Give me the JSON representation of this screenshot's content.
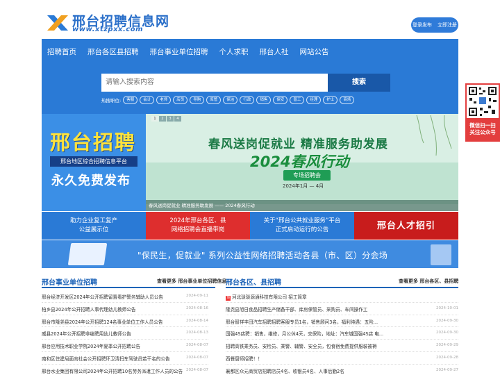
{
  "site": {
    "title": "邢台招聘信息网",
    "url": "www.xtzpxx.com",
    "brand_color": "#2a7ad6",
    "logo_icon": "x-logo-icon"
  },
  "account": {
    "login": "登录发布",
    "register": "立即注册"
  },
  "nav": [
    "招聘首页",
    "邢台各区县招聘",
    "邢台事业单位招聘",
    "个人求职",
    "邢台人社",
    "网站公告"
  ],
  "search": {
    "placeholder": "请输入搜索内容",
    "button": "搜索",
    "hot_label": "热搜职位:",
    "hot_tags": [
      "客服",
      "会计",
      "老师",
      "店员",
      "导购",
      "库管",
      "保洁",
      "行政",
      "销售",
      "保安",
      "普工",
      "经理",
      "护士",
      "商场"
    ]
  },
  "ad_left": {
    "title": "邢台招聘",
    "subtitle": "邢台地区综合招聘信息平台",
    "slogan": "永久免费发布"
  },
  "slide": {
    "pages": [
      "1",
      "2",
      "3",
      "4"
    ],
    "active_page": "1",
    "headline": "春风送岗促就业 精准服务助发展",
    "big": "2024春风行动",
    "pill": "专场招聘会",
    "date": "2024年1月 — 4月",
    "caption": "春风送岗促就业 精准服务助发展 —— 2024春风行动"
  },
  "ads4": {
    "a": [
      "助力企业复工复产",
      "公益展示位"
    ],
    "b": [
      "2024年邢台各区、县",
      "网络招聘会直播带岗"
    ],
    "c": [
      "关于“邢台公共就业服务”平台",
      "正式启动运行的公告"
    ],
    "d": "邢台人才招引"
  },
  "wide_banner": "\"保民生，促就业\" 系列公益性网络招聘活动各县（市、区）分会场",
  "sections": {
    "left": {
      "title": "邢台事业单位招聘",
      "more": "查看更多 邢台事业单位招聘信息",
      "items": [
        {
          "title": "邢台经济开发区2024年公开招聘留置看护警务辅助人员公告",
          "date": "2024-09-11"
        },
        {
          "title": "柏乡县2024年公开招聘人事代理幼儿教师公告",
          "date": "2024-08-16"
        },
        {
          "title": "邢台市隆尧县2024年公开招聘124名事业单位工作人员公告",
          "date": "2024-08-14"
        },
        {
          "title": "威县2024年公开招聘非编聘用幼儿教师公告",
          "date": "2024-08-13"
        },
        {
          "title": "邢台应用技术职业学院2024年夏季公开招聘公告",
          "date": "2024-08-07"
        },
        {
          "title": "南和区住建局面向社会公开招聘环卫清扫车驾驶员若干名的公告",
          "date": "2024-08-07"
        },
        {
          "title": "邢台水业集团有限公司2024年公开招聘10名劳务派遣工作人员的公告",
          "date": "2024-08-07"
        }
      ]
    },
    "right": {
      "title": "邢台各区、县招聘",
      "more": "查看更多 邢台各区、县招聘",
      "items": [
        {
          "title": "河北琰琰源通科技有限公司 招工简章",
          "date": "",
          "top": true
        },
        {
          "title": "隆尧县旭日食品招聘生产储备干部、库房保管员、采购员、车间操作工",
          "date": "2024-10-01"
        },
        {
          "title": "邢台智祥丰田汽车招聘招聘客服专员1名，销售顾问3名，福利待遇：五险...",
          "date": "2024-09-30"
        },
        {
          "title": "国强4S店聘：销售，维修，月公休4天，交保险，地址：汽车城国强4S店 电...",
          "date": "2024-09-30"
        },
        {
          "title": "招聘高铁乘务员、安检员、乘警、辅警、安全员，包食宿免费提供服装被褥",
          "date": "2024-09-29"
        },
        {
          "title": "西餐厨师招聘！！",
          "date": "2024-09-28"
        },
        {
          "title": "襄都区众元商贸店招聘店员4名、收银员4名、人事后勤2名",
          "date": "2024-09-27"
        }
      ]
    }
  },
  "qr": {
    "label_1": "微信扫一扫",
    "label_2": "关注公众号"
  }
}
